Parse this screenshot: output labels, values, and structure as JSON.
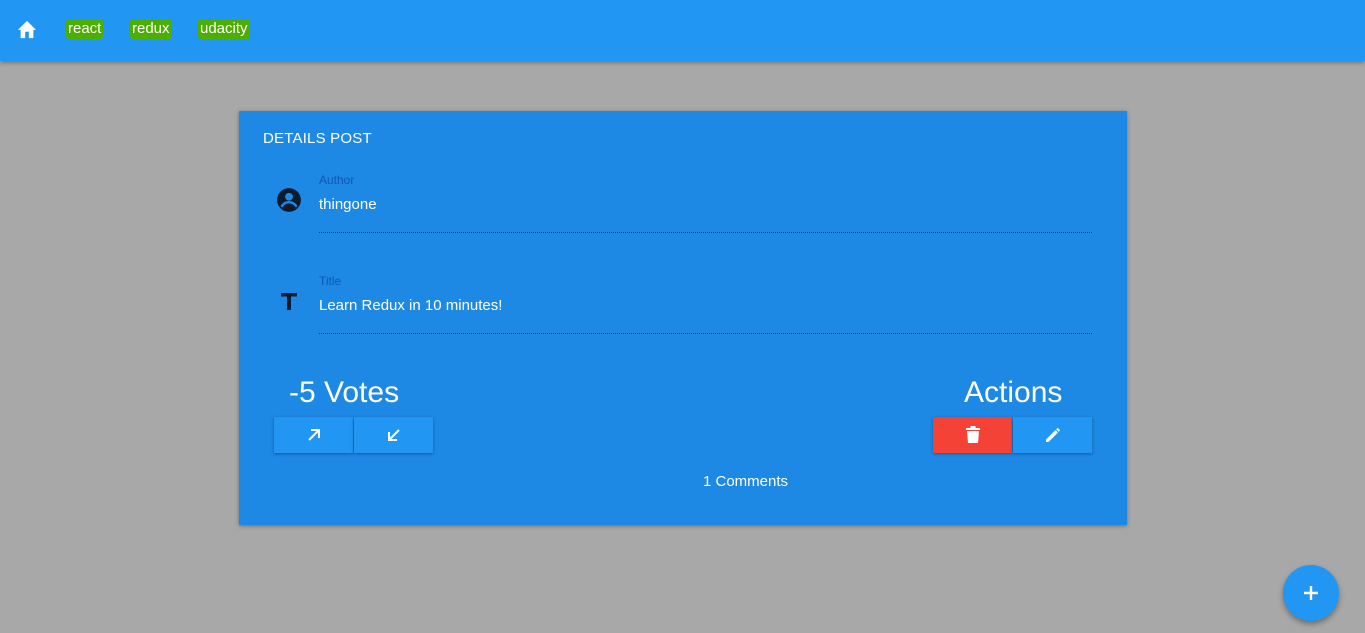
{
  "appbar": {
    "home_icon": "home-icon",
    "categories": [
      "react",
      "redux",
      "udacity"
    ],
    "category_highlight_color": "#4caf00"
  },
  "post": {
    "heading": "DETAILS POST",
    "author": {
      "label": "Author",
      "value": "thingone",
      "icon": "account-circle-icon"
    },
    "title": {
      "label": "Title",
      "value": "Learn Redux in 10 minutes!",
      "icon": "title-icon"
    },
    "votes_text": "-5 Votes",
    "actions_text": "Actions",
    "upvote_icon": "arrow-up-right-icon",
    "downvote_icon": "arrow-down-left-icon",
    "delete_icon": "trash-icon",
    "edit_icon": "pencil-icon",
    "comments_text": "1 Comments"
  },
  "fab": {
    "icon": "plus-icon"
  },
  "colors": {
    "appbar": "#2196f3",
    "card": "#1e88e5",
    "background": "#a8a8a8",
    "delete": "#f44336"
  }
}
